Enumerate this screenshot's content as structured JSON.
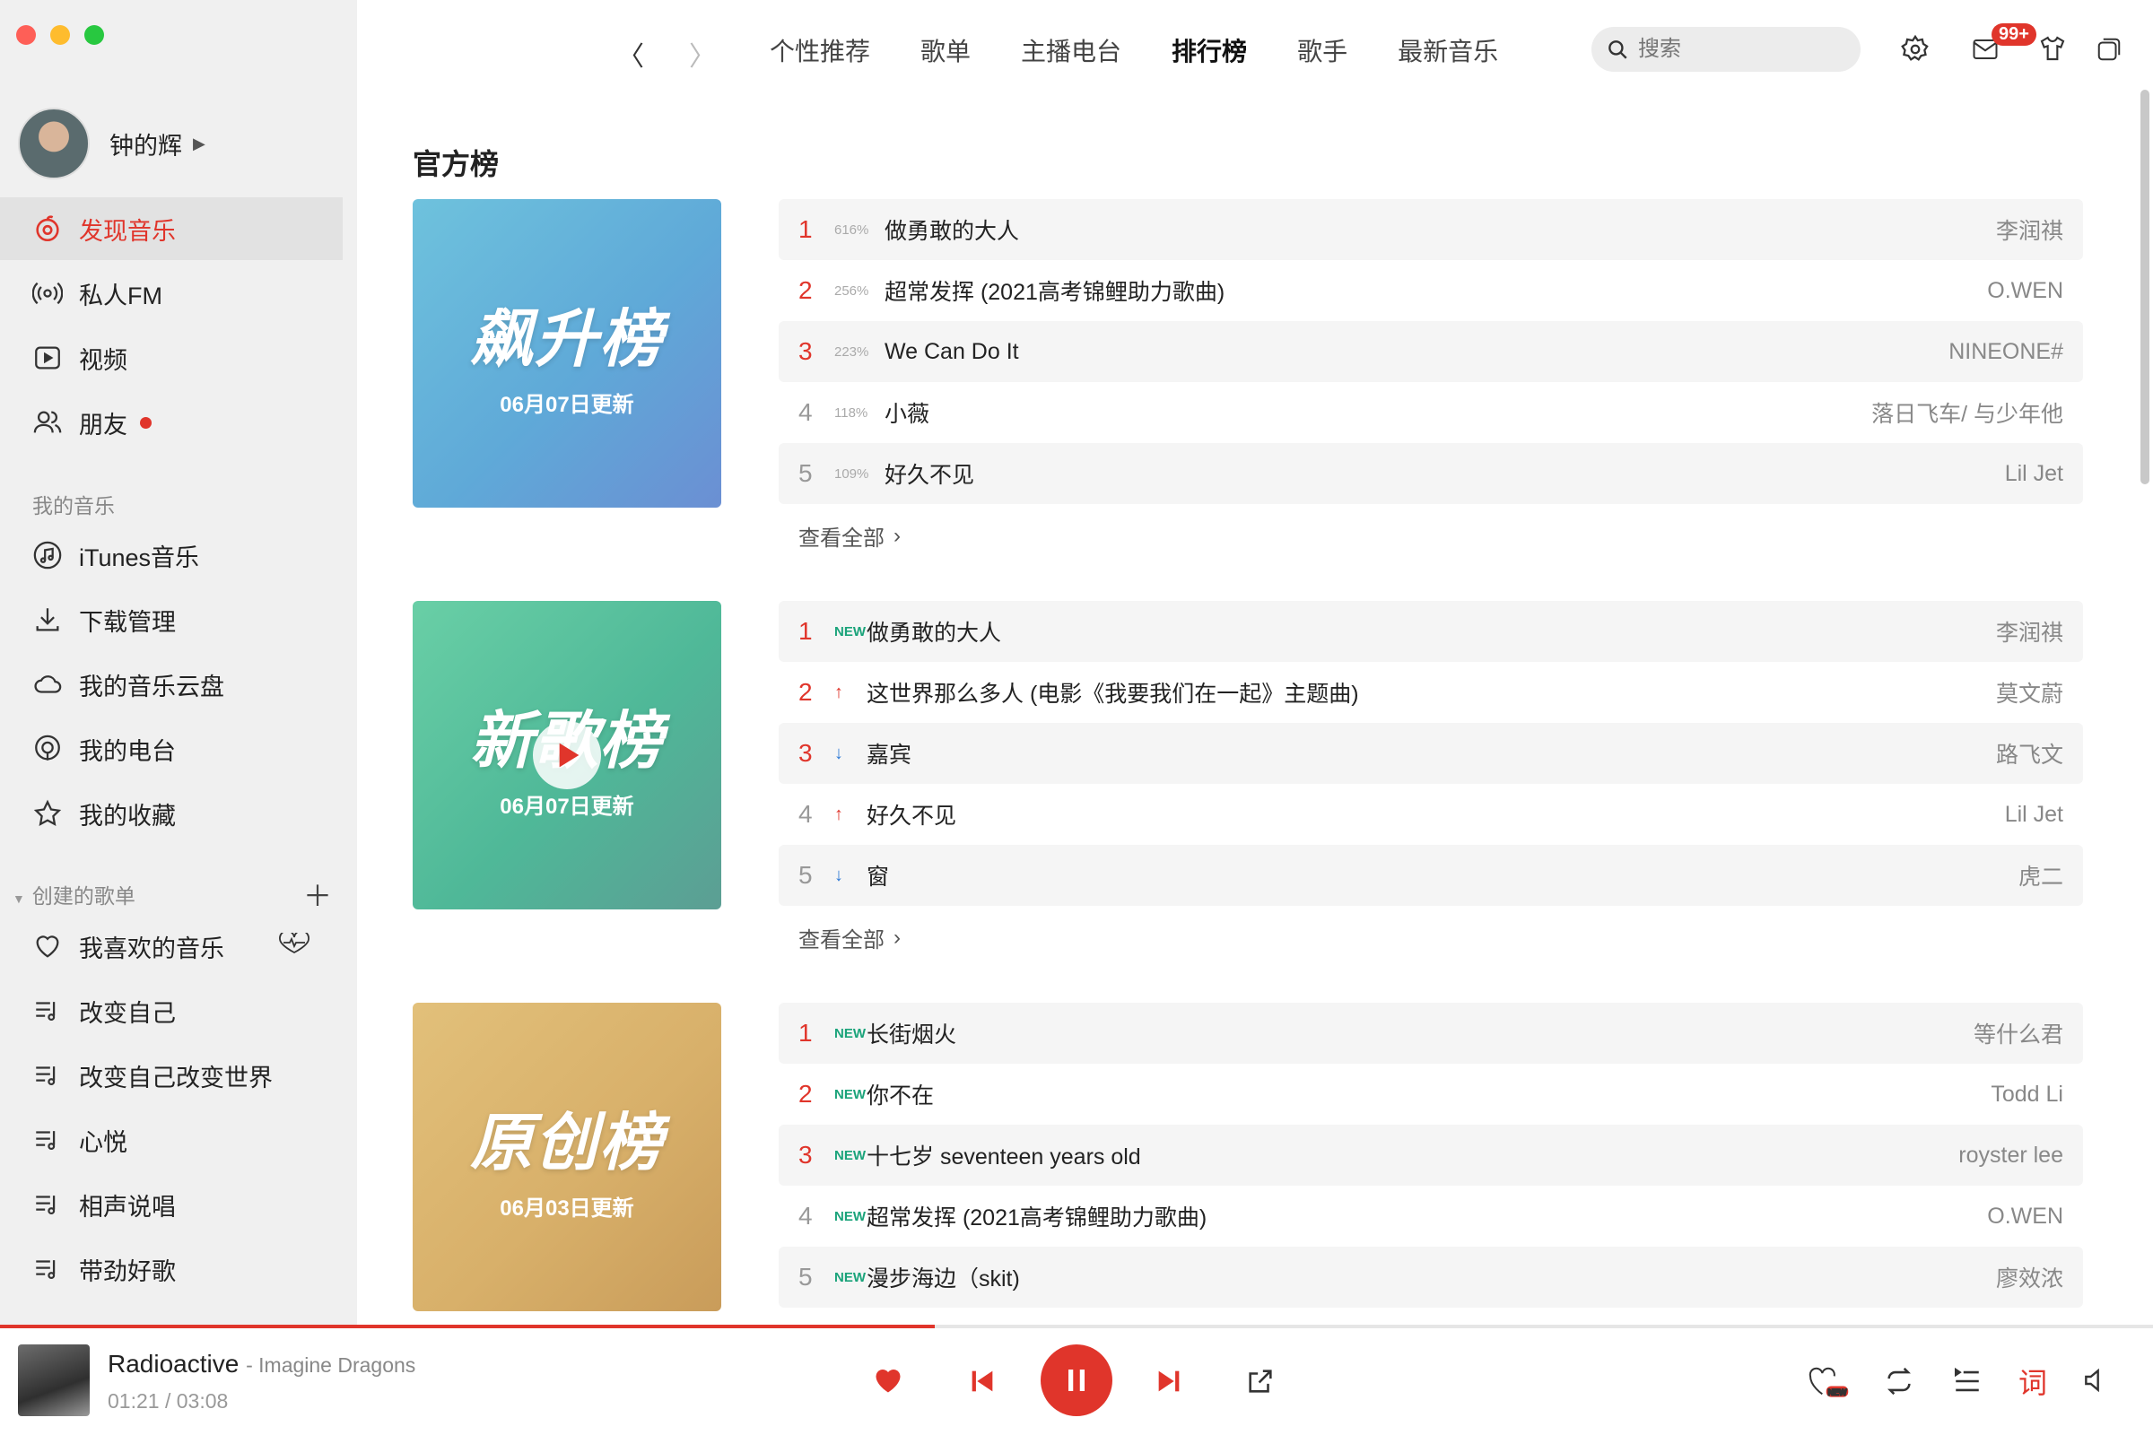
{
  "topbar": {
    "tabs": [
      "个性推荐",
      "歌单",
      "主播电台",
      "排行榜",
      "歌手",
      "最新音乐"
    ],
    "search_placeholder": "搜索",
    "mail_badge": "99+"
  },
  "sidebar": {
    "user_name": "钟的辉",
    "nav": [
      {
        "label": "发现音乐",
        "icon": "discover-icon"
      },
      {
        "label": "私人FM",
        "icon": "radio-icon"
      },
      {
        "label": "视频",
        "icon": "video-icon"
      },
      {
        "label": "朋友",
        "icon": "friends-icon"
      }
    ],
    "my_music_title": "我的音乐",
    "my_music": [
      {
        "label": "iTunes音乐",
        "icon": "music-note-icon"
      },
      {
        "label": "下载管理",
        "icon": "download-icon"
      },
      {
        "label": "我的音乐云盘",
        "icon": "cloud-icon"
      },
      {
        "label": "我的电台",
        "icon": "podcast-icon"
      },
      {
        "label": "我的收藏",
        "icon": "star-icon"
      }
    ],
    "created_title": "创建的歌单",
    "playlists": [
      "我喜欢的音乐",
      "改变自己",
      "改变自己改变世界",
      "心悦",
      "相声说唱",
      "带劲好歌"
    ]
  },
  "main": {
    "title": "官方榜",
    "view_all": "查看全部",
    "charts": [
      {
        "cover_title": "飙升榜",
        "cover_date": "06月07日更新",
        "color": "#6ec2dd",
        "rows": [
          {
            "rank": "1",
            "mark": "616%",
            "song": "做勇敢的大人",
            "artist": "李润祺"
          },
          {
            "rank": "2",
            "mark": "256%",
            "song": "超常发挥 (2021高考锦鲤助力歌曲)",
            "artist": "O.WEN"
          },
          {
            "rank": "3",
            "mark": "223%",
            "song": "We Can Do It",
            "artist": "NINEONE#"
          },
          {
            "rank": "4",
            "mark": "118%",
            "song": "小薇",
            "artist": "落日飞车/ 与少年他"
          },
          {
            "rank": "5",
            "mark": "109%",
            "song": "好久不见",
            "artist": "Lil Jet"
          }
        ]
      },
      {
        "cover_title": "新歌榜",
        "cover_date": "06月07日更新",
        "color": "#69cfa6",
        "rows": [
          {
            "rank": "1",
            "mark": "NEW",
            "song": "做勇敢的大人",
            "artist": "李润祺"
          },
          {
            "rank": "2",
            "mark": "↑",
            "song": "这世界那么多人 (电影《我要我们在一起》主题曲)",
            "artist": "莫文蔚"
          },
          {
            "rank": "3",
            "mark": "↓",
            "song": "嘉宾",
            "artist": "路飞文"
          },
          {
            "rank": "4",
            "mark": "↑",
            "song": "好久不见",
            "artist": "Lil Jet"
          },
          {
            "rank": "5",
            "mark": "↓",
            "song": "窗",
            "artist": "虎二"
          }
        ]
      },
      {
        "cover_title": "原创榜",
        "cover_date": "06月03日更新",
        "color": "#e2c07a",
        "rows": [
          {
            "rank": "1",
            "mark": "NEW",
            "song": "长街烟火",
            "artist": "等什么君"
          },
          {
            "rank": "2",
            "mark": "NEW",
            "song": "你不在",
            "artist": "Todd Li"
          },
          {
            "rank": "3",
            "mark": "NEW",
            "song": "十七岁 seventeen years old",
            "artist": "royster lee"
          },
          {
            "rank": "4",
            "mark": "NEW",
            "song": "超常发挥 (2021高考锦鲤助力歌曲)",
            "artist": "O.WEN"
          },
          {
            "rank": "5",
            "mark": "NEW",
            "song": "漫步海边（skit)",
            "artist": "廖效浓"
          }
        ]
      }
    ]
  },
  "player": {
    "title": "Radioactive",
    "artist": "- Imagine Dragons",
    "current": "01:21 /",
    "total": "03:08",
    "progress": 0.434,
    "lyric_label": "词",
    "accent": "#e0352b"
  }
}
